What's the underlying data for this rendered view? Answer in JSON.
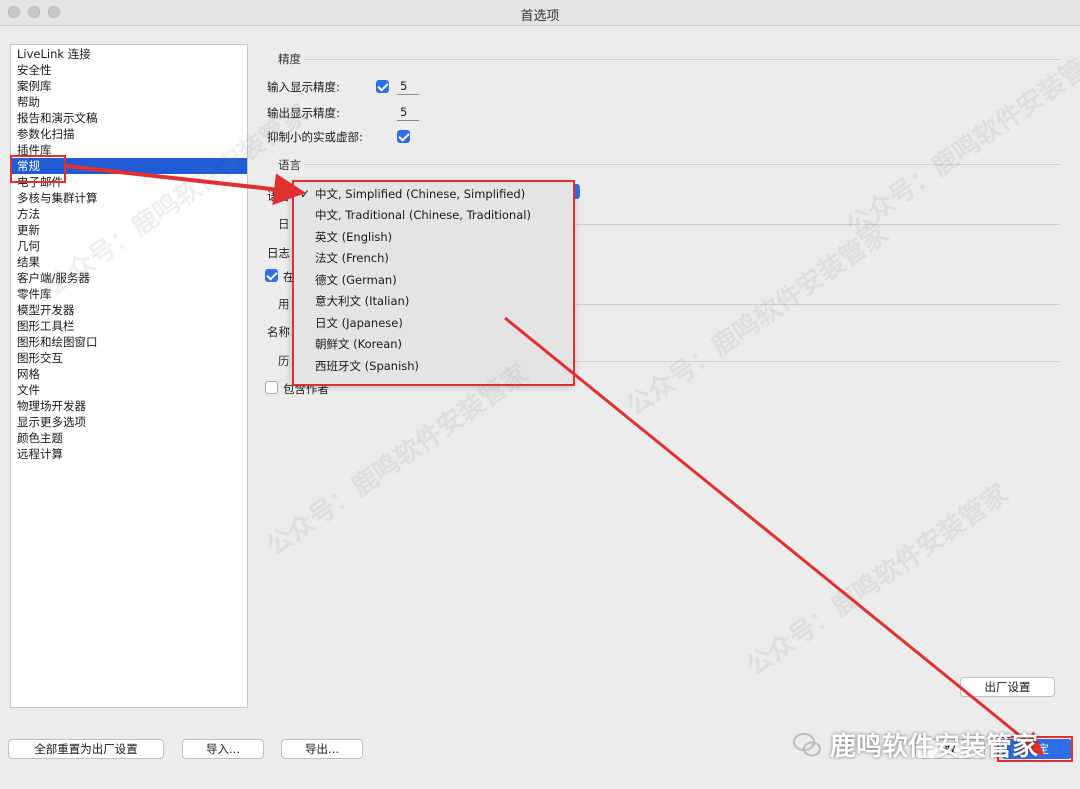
{
  "window": {
    "title": "首选项"
  },
  "sidebar": {
    "items": [
      {
        "label": "LiveLink 连接"
      },
      {
        "label": "安全性"
      },
      {
        "label": "案例库"
      },
      {
        "label": "帮助"
      },
      {
        "label": "报告和演示文稿"
      },
      {
        "label": "参数化扫描"
      },
      {
        "label": "插件库"
      },
      {
        "label": "常规",
        "selected": true
      },
      {
        "label": "电子邮件"
      },
      {
        "label": "多核与集群计算"
      },
      {
        "label": "方法"
      },
      {
        "label": "更新"
      },
      {
        "label": "几何"
      },
      {
        "label": "结果"
      },
      {
        "label": "客户端/服务器"
      },
      {
        "label": "零件库"
      },
      {
        "label": "模型开发器"
      },
      {
        "label": "图形工具栏"
      },
      {
        "label": "图形和绘图窗口"
      },
      {
        "label": "图形交互"
      },
      {
        "label": "网格"
      },
      {
        "label": "文件"
      },
      {
        "label": "物理场开发器"
      },
      {
        "label": "显示更多选项"
      },
      {
        "label": "颜色主题"
      },
      {
        "label": "远程计算"
      }
    ]
  },
  "precision": {
    "section_label": "精度",
    "input_label": "输入显示精度:",
    "input_checked": true,
    "input_value": "5",
    "output_label": "输出显示精度:",
    "output_value": "5",
    "suppress_label": "抑制小的实或虚部:",
    "suppress_checked": true
  },
  "language": {
    "section_label": "语言",
    "field_label_fragment": "语言",
    "selected": "中文, Simplified (Chinese, Simplified)",
    "options": [
      "中文, Simplified (Chinese, Simplified)",
      "中文, Traditional (Chinese, Traditional)",
      "英文 (English)",
      "法文 (French)",
      "德文 (German)",
      "意大利文 (Italian)",
      "日文 (Japanese)",
      "朝鲜文 (Korean)",
      "西班牙文 (Spanish)"
    ]
  },
  "partial": {
    "log_section_fragment": "日",
    "log_label_fragment": "日志",
    "log_checkbox_fragment": "在",
    "user_section_fragment": "用",
    "name_label_fragment": "名称",
    "history_section_fragment": "历",
    "include_author_fragment": "包含作者"
  },
  "buttons": {
    "factory": "出厂设置",
    "reset_all": "全部重置为出厂设置",
    "import": "导入...",
    "export": "导出...",
    "cancel_fragment": "取",
    "ok_fragment": "定"
  },
  "watermark": {
    "text": "公众号：鹿鸣软件安装管家",
    "brand": "鹿鸣软件安装管家"
  },
  "colors": {
    "accent": "#2f6fe6",
    "selection": "#1e5bd6",
    "annotation": "#e03030"
  }
}
